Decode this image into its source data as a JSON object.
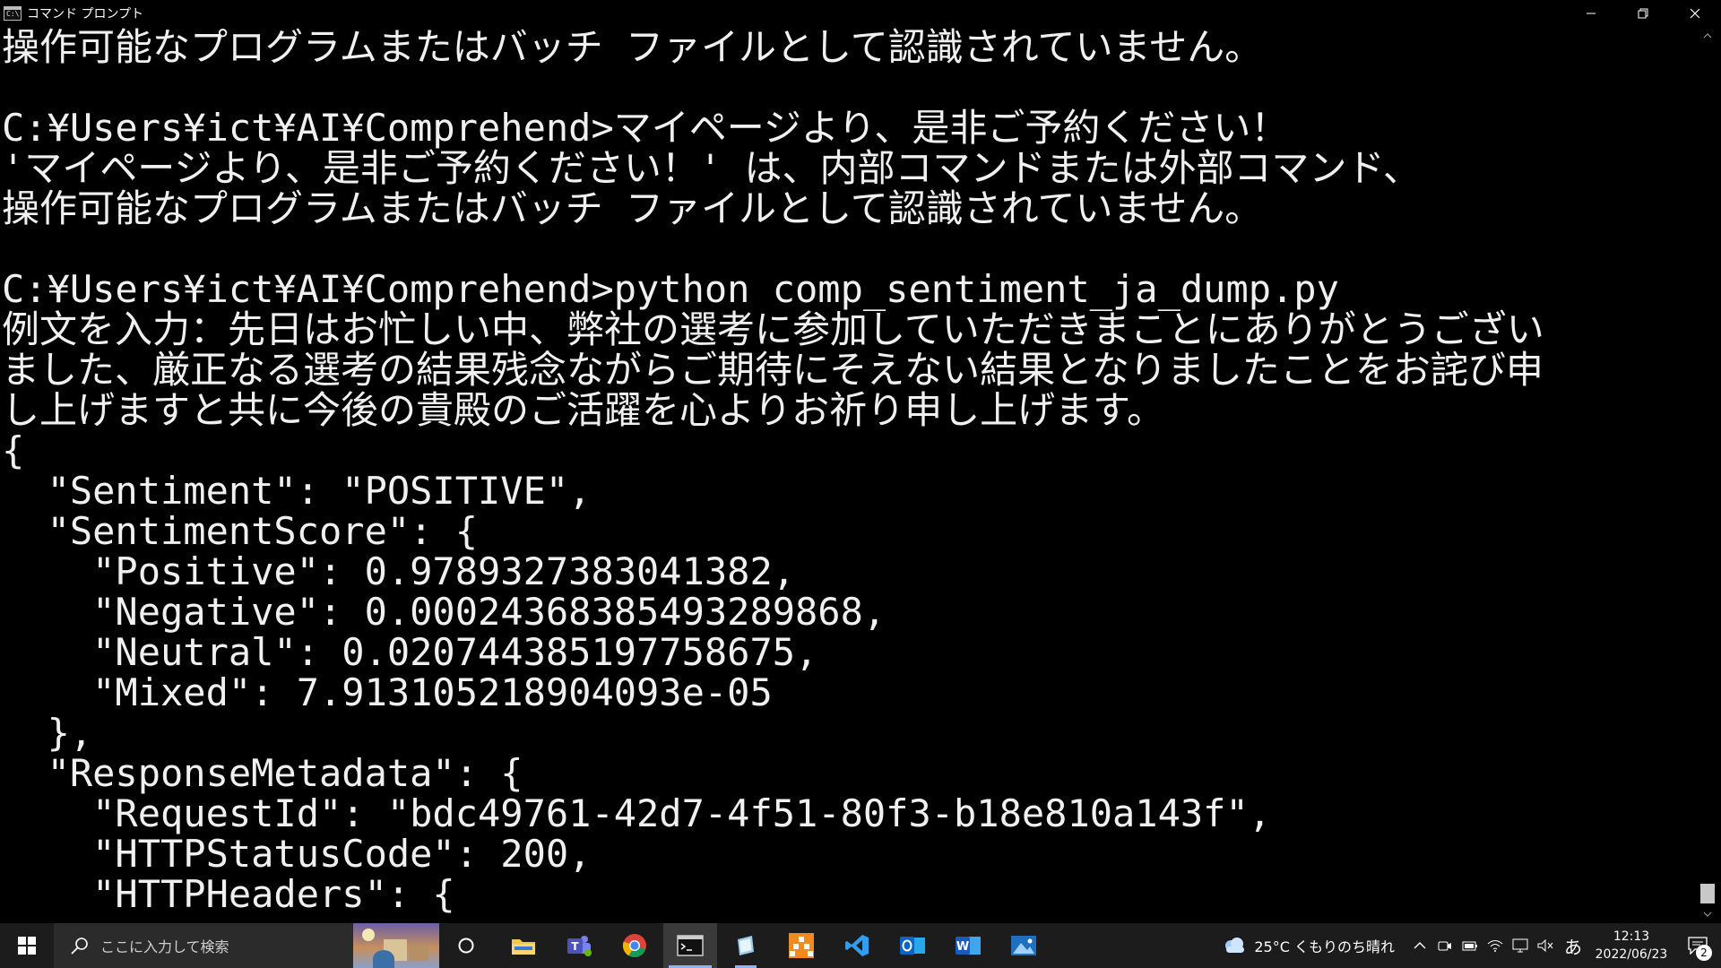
{
  "window": {
    "title": "コマンド プロンプト",
    "app_icon_text": "C:\\"
  },
  "console": {
    "lines": [
      "操作可能なプログラムまたはバッチ ファイルとして認識されていません。",
      "",
      "C:¥Users¥ict¥AI¥Comprehend>マイページより、是非ご予約ください！",
      "'マイページより、是非ご予約ください！' は、内部コマンドまたは外部コマンド、",
      "操作可能なプログラムまたはバッチ ファイルとして認識されていません。",
      "",
      "C:¥Users¥ict¥AI¥Comprehend>python comp_sentiment_ja_dump.py",
      "例文を入力：先日はお忙しい中、弊社の選考に参加していただきまことにありがとうござい",
      "ました、厳正なる選考の結果残念ながらご期待にそえない結果となりましたことをお詫び申",
      "し上げますと共に今後の貴殿のご活躍を心よりお祈り申し上げます。",
      "{",
      "  \"Sentiment\": \"POSITIVE\",",
      "  \"SentimentScore\": {",
      "    \"Positive\": 0.9789327383041382,",
      "    \"Negative\": 0.00024368385493289868,",
      "    \"Neutral\": 0.020744385197758675,",
      "    \"Mixed\": 7.913105218904093e-05",
      "  },",
      "  \"ResponseMetadata\": {",
      "    \"RequestId\": \"bdc49761-42d7-4f51-80f3-b18e810a143f\",",
      "    \"HTTPStatusCode\": 200,",
      "    \"HTTPHeaders\": {"
    ]
  },
  "taskbar": {
    "search_placeholder": "ここに入力して検索",
    "apps": [
      {
        "name": "cortana-icon"
      },
      {
        "name": "file-explorer-icon"
      },
      {
        "name": "teams-icon"
      },
      {
        "name": "chrome-icon"
      },
      {
        "name": "command-prompt-icon"
      },
      {
        "name": "notepad-app-icon"
      },
      {
        "name": "orange-app-icon"
      },
      {
        "name": "vscode-icon"
      },
      {
        "name": "outlook-icon"
      },
      {
        "name": "word-icon"
      },
      {
        "name": "photos-icon"
      }
    ],
    "weather": "25°C くもりのち晴れ",
    "ime_mode": "あ",
    "time": "12:13",
    "date": "2022/06/23",
    "notification_count": "2"
  }
}
